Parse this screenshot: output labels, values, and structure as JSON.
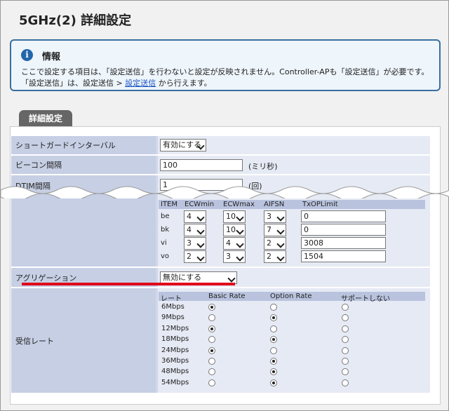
{
  "page_title": "5GHz(2) 詳細設定",
  "info": {
    "title": "情報",
    "line1": "ここで設定する項目は、「設定送信」を行わないと設定が反映されません。Controller-APも「設定送信」が必要です。",
    "line2_pre": "「設定送信」は、設定送信 > ",
    "line2_link": "設定送信",
    "line2_post": " から行えます。"
  },
  "tab": "詳細設定",
  "rows": {
    "guard": {
      "label": "ショートガードインターバル",
      "value": "有効にする"
    },
    "beacon": {
      "label": "ビーコン間隔",
      "value": "100",
      "unit": "(ミリ秒)"
    },
    "dtim": {
      "label": "DTIM間隔",
      "value": "1",
      "unit": "(回)"
    },
    "agg": {
      "label": "アグリゲーション",
      "value": "無効にする"
    },
    "rate": {
      "label": "受信レート"
    }
  },
  "wmm": {
    "headers": [
      "ITEM",
      "ECWmin",
      "ECWmax",
      "AIFSN",
      "TxOPLimit"
    ],
    "rows": [
      {
        "item": "be",
        "ecwmin": "4",
        "ecwmax": "10",
        "aifsn": "3",
        "txop": "0"
      },
      {
        "item": "bk",
        "ecwmin": "4",
        "ecwmax": "10",
        "aifsn": "7",
        "txop": "0"
      },
      {
        "item": "vi",
        "ecwmin": "3",
        "ecwmax": "4",
        "aifsn": "2",
        "txop": "3008"
      },
      {
        "item": "vo",
        "ecwmin": "2",
        "ecwmax": "3",
        "aifsn": "2",
        "txop": "1504"
      }
    ]
  },
  "rates": {
    "headers": [
      "レート",
      "Basic Rate",
      "Option Rate",
      "サポートしない"
    ],
    "rows": [
      {
        "rate": "6Mbps",
        "selected": "basic"
      },
      {
        "rate": "9Mbps",
        "selected": "option"
      },
      {
        "rate": "12Mbps",
        "selected": "basic"
      },
      {
        "rate": "18Mbps",
        "selected": "option"
      },
      {
        "rate": "24Mbps",
        "selected": "basic"
      },
      {
        "rate": "36Mbps",
        "selected": "option"
      },
      {
        "rate": "48Mbps",
        "selected": "option"
      },
      {
        "rate": "54Mbps",
        "selected": "option"
      }
    ]
  }
}
